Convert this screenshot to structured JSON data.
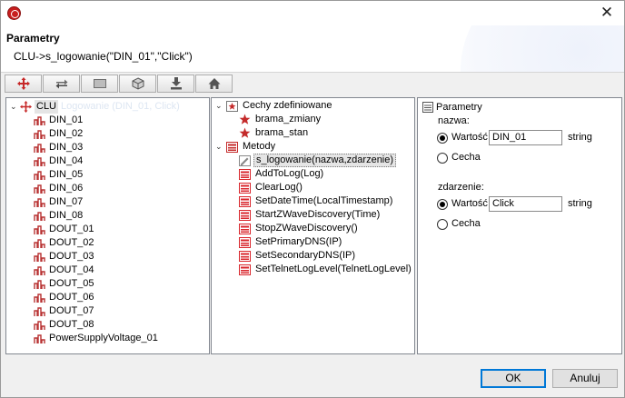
{
  "window": {
    "close_glyph": "✕"
  },
  "header": {
    "title": "Parametry",
    "subtitle": "CLU->s_logowanie(\"DIN_01\",\"Click\")"
  },
  "toolbar": {
    "buttons": [
      {
        "name": "move-icon"
      },
      {
        "name": "swap-icon"
      },
      {
        "name": "panel-icon"
      },
      {
        "name": "cube-icon"
      },
      {
        "name": "import-icon"
      },
      {
        "name": "home-icon"
      }
    ]
  },
  "objects_tree": {
    "root": {
      "label": "CLU",
      "ghost_text": "Logowanie (DIN_01, Click)"
    },
    "items": [
      "DIN_01",
      "DIN_02",
      "DIN_03",
      "DIN_04",
      "DIN_05",
      "DIN_06",
      "DIN_07",
      "DIN_08",
      "DOUT_01",
      "DOUT_02",
      "DOUT_03",
      "DOUT_04",
      "DOUT_05",
      "DOUT_06",
      "DOUT_07",
      "DOUT_08",
      "PowerSupplyVoltage_01"
    ]
  },
  "features_tree": {
    "features_group": {
      "label": "Cechy zdefiniowane",
      "items": [
        "brama_zmiany",
        "brama_stan"
      ]
    },
    "methods_group": {
      "label": "Metody",
      "items": [
        "s_logowanie(nazwa,zdarzenie)",
        "AddToLog(Log)",
        "ClearLog()",
        "SetDateTime(LocalTimestamp)",
        "StartZWaveDiscovery(Time)",
        "StopZWaveDiscovery()",
        "SetPrimaryDNS(IP)",
        "SetSecondaryDNS(IP)",
        "SetTelnetLogLevel(TelnetLogLevel)"
      ],
      "selected": "s_logowanie(nazwa,zdarzenie)"
    }
  },
  "params_panel": {
    "title": "Parametry",
    "params": [
      {
        "label": "nazwa:",
        "value_radio": "Wartość",
        "value": "DIN_01",
        "type": "string",
        "feature_radio": "Cecha",
        "selected": "value"
      },
      {
        "label": "zdarzenie:",
        "value_radio": "Wartość",
        "value": "Click",
        "type": "string",
        "feature_radio": "Cecha",
        "selected": "value"
      }
    ]
  },
  "footer": {
    "ok_label": "OK",
    "cancel_label": "Anuluj"
  },
  "colors": {
    "accent": "#0078d7",
    "app_icon": "#c81e1e",
    "method_icon": "#d9262c",
    "feature_star": "#c42a2a"
  }
}
